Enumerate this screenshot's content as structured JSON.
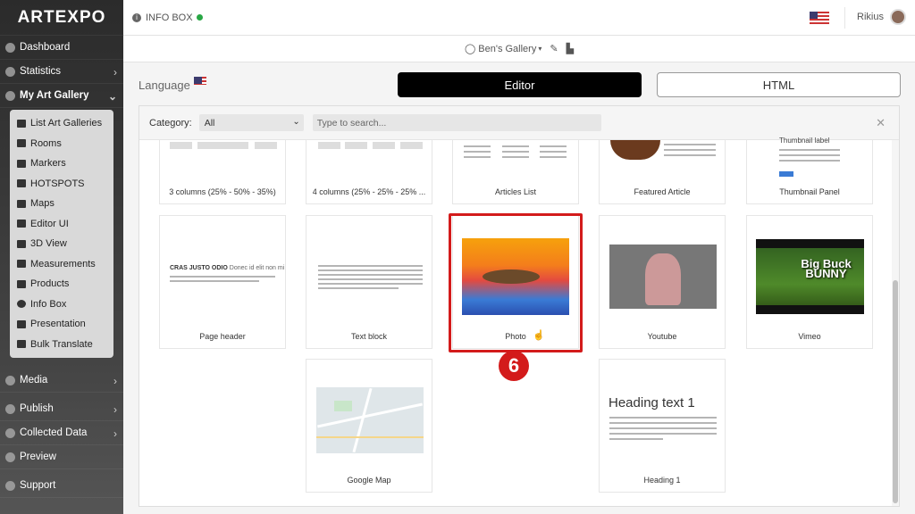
{
  "app": {
    "logo": "ARTEXPO"
  },
  "topbar": {
    "section": "INFO BOX",
    "user": "Rikius"
  },
  "subbar": {
    "gallery": "Ben's Gallery"
  },
  "sidebar": {
    "items": [
      {
        "label": "Dashboard"
      },
      {
        "label": "Statistics"
      },
      {
        "label": "My Art Gallery"
      }
    ],
    "submenu": [
      {
        "label": "List Art Galleries"
      },
      {
        "label": "Rooms"
      },
      {
        "label": "Markers"
      },
      {
        "label": "HOTSPOTS"
      },
      {
        "label": "Maps"
      },
      {
        "label": "Editor UI"
      },
      {
        "label": "3D View"
      },
      {
        "label": "Measurements"
      },
      {
        "label": "Products"
      },
      {
        "label": "Info Box"
      },
      {
        "label": "Presentation"
      },
      {
        "label": "Bulk Translate"
      }
    ],
    "bottom": [
      {
        "label": "Media"
      },
      {
        "label": "Publish"
      },
      {
        "label": "Collected Data"
      },
      {
        "label": "Preview"
      },
      {
        "label": "Support"
      }
    ]
  },
  "content": {
    "language_label": "Language",
    "editor_tab": "Editor",
    "html_tab": "HTML"
  },
  "filter": {
    "category_label": "Category:",
    "category_value": "All",
    "search_placeholder": "Type to search..."
  },
  "cards": {
    "c1": "3 columns (25% - 50% - 35%)",
    "c2": "4 columns (25% - 25% - 25% ...",
    "c3": "Articles List",
    "c4": "Featured Article",
    "c5": "Thumbnail Panel",
    "c6": "Page header",
    "c7": "Text block",
    "c8": "Photo",
    "c9": "Youtube",
    "c10": "Vimeo",
    "c11": "Google Map",
    "c12": "Heading 1"
  },
  "previews": {
    "page_header_bold": "CRAS JUSTO ODIO",
    "page_header_rest": "Donec id elit non mi",
    "heading_text": "Heading text 1",
    "vimeo_title": "Big Buck BUNNY",
    "thumbnail_label": "Thumbnail label"
  },
  "step_badge": "6"
}
